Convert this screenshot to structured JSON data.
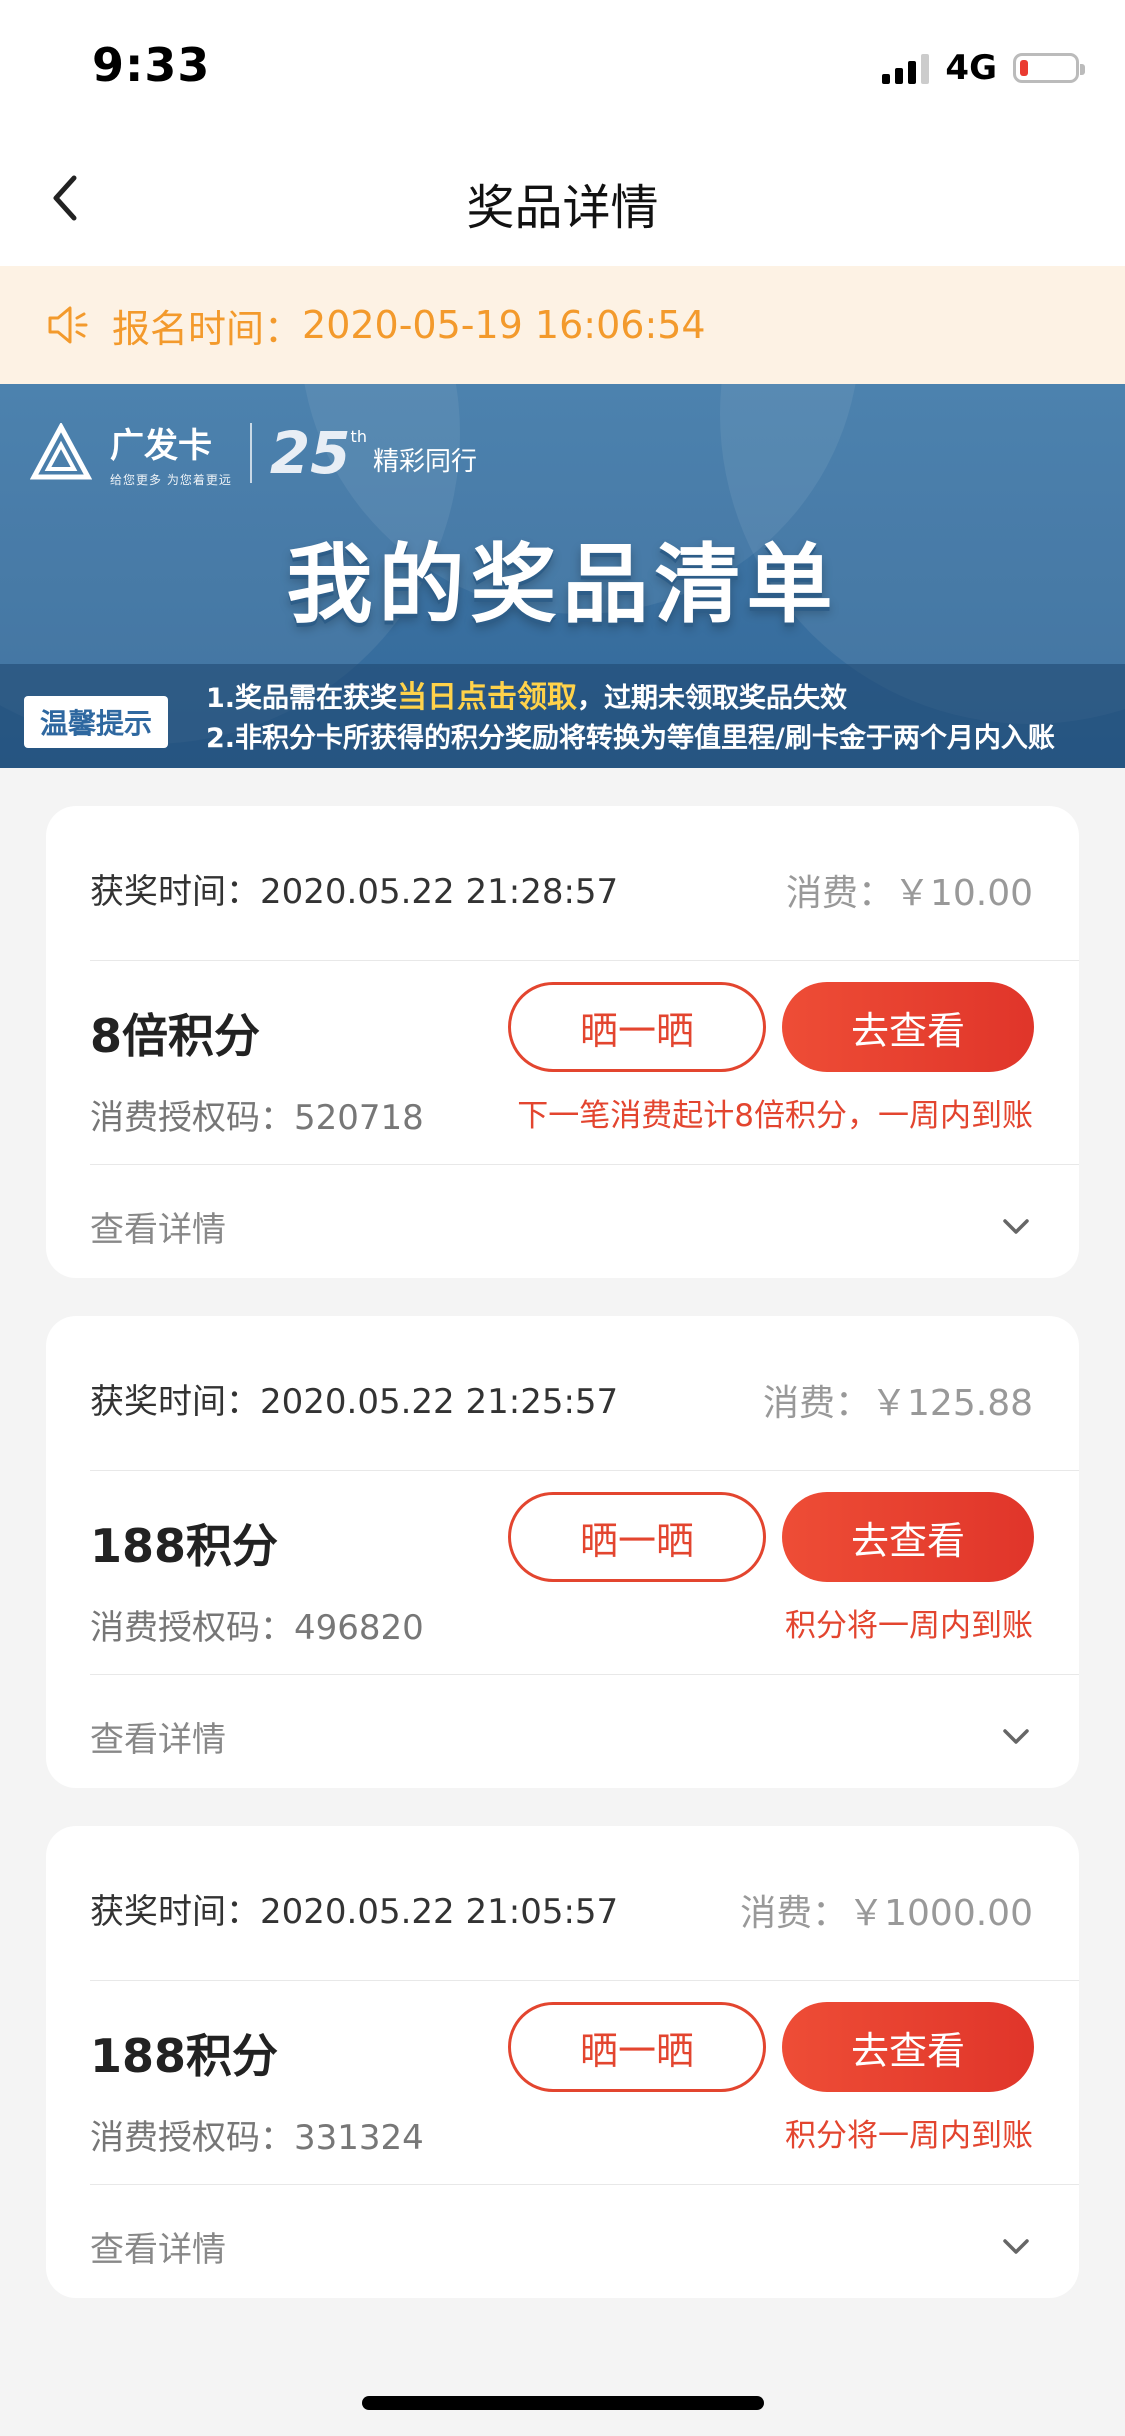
{
  "status_bar": {
    "time": "9:33",
    "network": "4G"
  },
  "nav": {
    "title": "奖品详情"
  },
  "notice": {
    "label": "报名时间：",
    "value": "2020-05-19 16:06:54"
  },
  "banner": {
    "brand": "广发卡",
    "brand_tagline": "给您更多  为您着更远",
    "anniversary": "25",
    "anniversary_sup": "th",
    "anniversary_text": "精彩同行",
    "title": "我的奖品清单",
    "tip_badge": "温馨提示",
    "tip1_pre": "1.奖品需在获奖",
    "tip1_highlight": "当日点击领取",
    "tip1_post": "，过期未领取奖品失效",
    "tip2": "2.非积分卡所获得的积分奖励将转换为等值里程/刷卡金于两个月内入账"
  },
  "cards": [
    {
      "win_label": "获奖时间：",
      "win_time": "2020.05.22 21:28:57",
      "spend": "消费：￥10.00",
      "prize": "8倍积分",
      "auth": "消费授权码：520718",
      "share": "晒一晒",
      "view": "去查看",
      "note": "下一笔消费起计8倍积分，一周内到账",
      "details": "查看详情"
    },
    {
      "win_label": "获奖时间：",
      "win_time": "2020.05.22 21:25:57",
      "spend": "消费：￥125.88",
      "prize": "188积分",
      "auth": "消费授权码：496820",
      "share": "晒一晒",
      "view": "去查看",
      "note": "积分将一周内到账",
      "details": "查看详情"
    },
    {
      "win_label": "获奖时间：",
      "win_time": "2020.05.22 21:05:57",
      "spend": "消费：￥1000.00",
      "prize": "188积分",
      "auth": "消费授权码：331324",
      "share": "晒一晒",
      "view": "去查看",
      "note": "积分将一周内到账",
      "details": "查看详情"
    }
  ],
  "colors": {
    "accent": "#e3452f",
    "notice": "#f39a2c",
    "banner": "#3a70a0"
  }
}
